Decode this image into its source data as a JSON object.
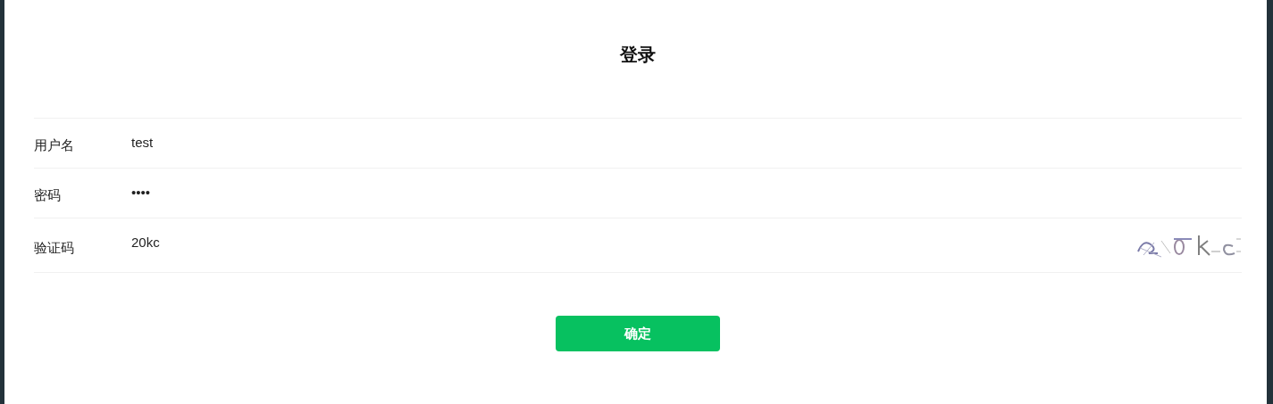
{
  "title": "登录",
  "fields": [
    {
      "label": "用户名",
      "value": "test",
      "kind": "text"
    },
    {
      "label": "密码",
      "value": "••••",
      "kind": "text"
    },
    {
      "label": "验证码",
      "value": "20kc",
      "kind": "captcha"
    }
  ],
  "button": "确定"
}
